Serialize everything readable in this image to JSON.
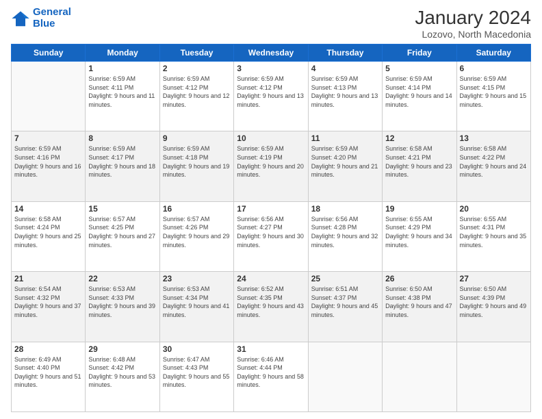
{
  "logo": {
    "line1": "General",
    "line2": "Blue"
  },
  "title": "January 2024",
  "location": "Lozovo, North Macedonia",
  "days_of_week": [
    "Sunday",
    "Monday",
    "Tuesday",
    "Wednesday",
    "Thursday",
    "Friday",
    "Saturday"
  ],
  "weeks": [
    [
      {
        "day": "",
        "info": ""
      },
      {
        "day": "1",
        "sunrise": "6:59 AM",
        "sunset": "4:11 PM",
        "daylight": "9 hours and 11 minutes."
      },
      {
        "day": "2",
        "sunrise": "6:59 AM",
        "sunset": "4:12 PM",
        "daylight": "9 hours and 12 minutes."
      },
      {
        "day": "3",
        "sunrise": "6:59 AM",
        "sunset": "4:12 PM",
        "daylight": "9 hours and 13 minutes."
      },
      {
        "day": "4",
        "sunrise": "6:59 AM",
        "sunset": "4:13 PM",
        "daylight": "9 hours and 13 minutes."
      },
      {
        "day": "5",
        "sunrise": "6:59 AM",
        "sunset": "4:14 PM",
        "daylight": "9 hours and 14 minutes."
      },
      {
        "day": "6",
        "sunrise": "6:59 AM",
        "sunset": "4:15 PM",
        "daylight": "9 hours and 15 minutes."
      }
    ],
    [
      {
        "day": "7",
        "sunrise": "6:59 AM",
        "sunset": "4:16 PM",
        "daylight": "9 hours and 16 minutes."
      },
      {
        "day": "8",
        "sunrise": "6:59 AM",
        "sunset": "4:17 PM",
        "daylight": "9 hours and 18 minutes."
      },
      {
        "day": "9",
        "sunrise": "6:59 AM",
        "sunset": "4:18 PM",
        "daylight": "9 hours and 19 minutes."
      },
      {
        "day": "10",
        "sunrise": "6:59 AM",
        "sunset": "4:19 PM",
        "daylight": "9 hours and 20 minutes."
      },
      {
        "day": "11",
        "sunrise": "6:59 AM",
        "sunset": "4:20 PM",
        "daylight": "9 hours and 21 minutes."
      },
      {
        "day": "12",
        "sunrise": "6:58 AM",
        "sunset": "4:21 PM",
        "daylight": "9 hours and 23 minutes."
      },
      {
        "day": "13",
        "sunrise": "6:58 AM",
        "sunset": "4:22 PM",
        "daylight": "9 hours and 24 minutes."
      }
    ],
    [
      {
        "day": "14",
        "sunrise": "6:58 AM",
        "sunset": "4:24 PM",
        "daylight": "9 hours and 25 minutes."
      },
      {
        "day": "15",
        "sunrise": "6:57 AM",
        "sunset": "4:25 PM",
        "daylight": "9 hours and 27 minutes."
      },
      {
        "day": "16",
        "sunrise": "6:57 AM",
        "sunset": "4:26 PM",
        "daylight": "9 hours and 29 minutes."
      },
      {
        "day": "17",
        "sunrise": "6:56 AM",
        "sunset": "4:27 PM",
        "daylight": "9 hours and 30 minutes."
      },
      {
        "day": "18",
        "sunrise": "6:56 AM",
        "sunset": "4:28 PM",
        "daylight": "9 hours and 32 minutes."
      },
      {
        "day": "19",
        "sunrise": "6:55 AM",
        "sunset": "4:29 PM",
        "daylight": "9 hours and 34 minutes."
      },
      {
        "day": "20",
        "sunrise": "6:55 AM",
        "sunset": "4:31 PM",
        "daylight": "9 hours and 35 minutes."
      }
    ],
    [
      {
        "day": "21",
        "sunrise": "6:54 AM",
        "sunset": "4:32 PM",
        "daylight": "9 hours and 37 minutes."
      },
      {
        "day": "22",
        "sunrise": "6:53 AM",
        "sunset": "4:33 PM",
        "daylight": "9 hours and 39 minutes."
      },
      {
        "day": "23",
        "sunrise": "6:53 AM",
        "sunset": "4:34 PM",
        "daylight": "9 hours and 41 minutes."
      },
      {
        "day": "24",
        "sunrise": "6:52 AM",
        "sunset": "4:35 PM",
        "daylight": "9 hours and 43 minutes."
      },
      {
        "day": "25",
        "sunrise": "6:51 AM",
        "sunset": "4:37 PM",
        "daylight": "9 hours and 45 minutes."
      },
      {
        "day": "26",
        "sunrise": "6:50 AM",
        "sunset": "4:38 PM",
        "daylight": "9 hours and 47 minutes."
      },
      {
        "day": "27",
        "sunrise": "6:50 AM",
        "sunset": "4:39 PM",
        "daylight": "9 hours and 49 minutes."
      }
    ],
    [
      {
        "day": "28",
        "sunrise": "6:49 AM",
        "sunset": "4:40 PM",
        "daylight": "9 hours and 51 minutes."
      },
      {
        "day": "29",
        "sunrise": "6:48 AM",
        "sunset": "4:42 PM",
        "daylight": "9 hours and 53 minutes."
      },
      {
        "day": "30",
        "sunrise": "6:47 AM",
        "sunset": "4:43 PM",
        "daylight": "9 hours and 55 minutes."
      },
      {
        "day": "31",
        "sunrise": "6:46 AM",
        "sunset": "4:44 PM",
        "daylight": "9 hours and 58 minutes."
      },
      {
        "day": "",
        "info": ""
      },
      {
        "day": "",
        "info": ""
      },
      {
        "day": "",
        "info": ""
      }
    ]
  ],
  "labels": {
    "sunrise": "Sunrise:",
    "sunset": "Sunset:",
    "daylight": "Daylight:"
  },
  "colors": {
    "header_bg": "#1565c0",
    "alt_row": "#f2f2f2"
  }
}
